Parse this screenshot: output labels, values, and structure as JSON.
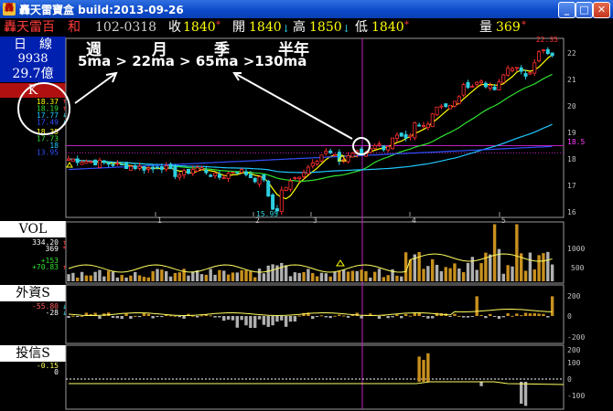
{
  "window": {
    "title": "轟天雷寶盒 build:2013-09-26",
    "minimize": "_",
    "maximize": "□",
    "close": "✕"
  },
  "header": {
    "stock_name": "轟天雷百　和",
    "stock_code": "102-0318",
    "close_label": "收",
    "close_value": "1840",
    "open_label": "開",
    "open_value": "1840",
    "high_label": "高",
    "high_value": "1850",
    "low_label": "低",
    "low_value": "1840",
    "volume_label": "量",
    "volume_value": "369",
    "arrow_up": "↑",
    "arrow_down": "↓",
    "arrow_star": "*"
  },
  "left_panel": {
    "period": "日　線",
    "index_value": "9938",
    "turnover": "29.7億",
    "k_label": "K",
    "ma_values": [
      "18.37",
      "18.19",
      "17.77",
      "17.49"
    ],
    "ma_values_b": [
      "18.35",
      "17.73",
      "18",
      "13.95"
    ],
    "vol_label": "VOL",
    "vol_values": [
      "334.20",
      "369"
    ],
    "vol_values_b": [
      "+153",
      "+70.83"
    ],
    "foreign_label": "外資S",
    "foreign_values": [
      "-55.80",
      "-28"
    ],
    "trust_label": "投信S",
    "trust_values": [
      "-0.15",
      "0"
    ]
  },
  "annotations": {
    "periods": [
      "週",
      "月",
      "季",
      "半年"
    ],
    "ma_order": "5ma > 22ma > 65ma >130ma"
  },
  "chart_labels": {
    "price_high": "22.35",
    "price_low": "15.95",
    "price_marker": "18.5",
    "price_axis": [
      "22",
      "21",
      "20",
      "19",
      "18",
      "17",
      "16"
    ],
    "months": [
      "1",
      "2",
      "3",
      "4",
      "5"
    ],
    "vol_axis": [
      "1000",
      "500"
    ],
    "foreign_axis": [
      "200",
      "0",
      "-200"
    ],
    "trust_axis": [
      "200",
      "100",
      "0",
      "-100"
    ]
  },
  "colors": {
    "up": "#ff3030",
    "down": "#2ecfe0",
    "ma5": "#ffff00",
    "ma22": "#30e030",
    "ma65": "#1ec8ff",
    "ma130": "#3050ff",
    "bar": "#c8901e",
    "neg_bar": "#b0b0b0"
  }
}
